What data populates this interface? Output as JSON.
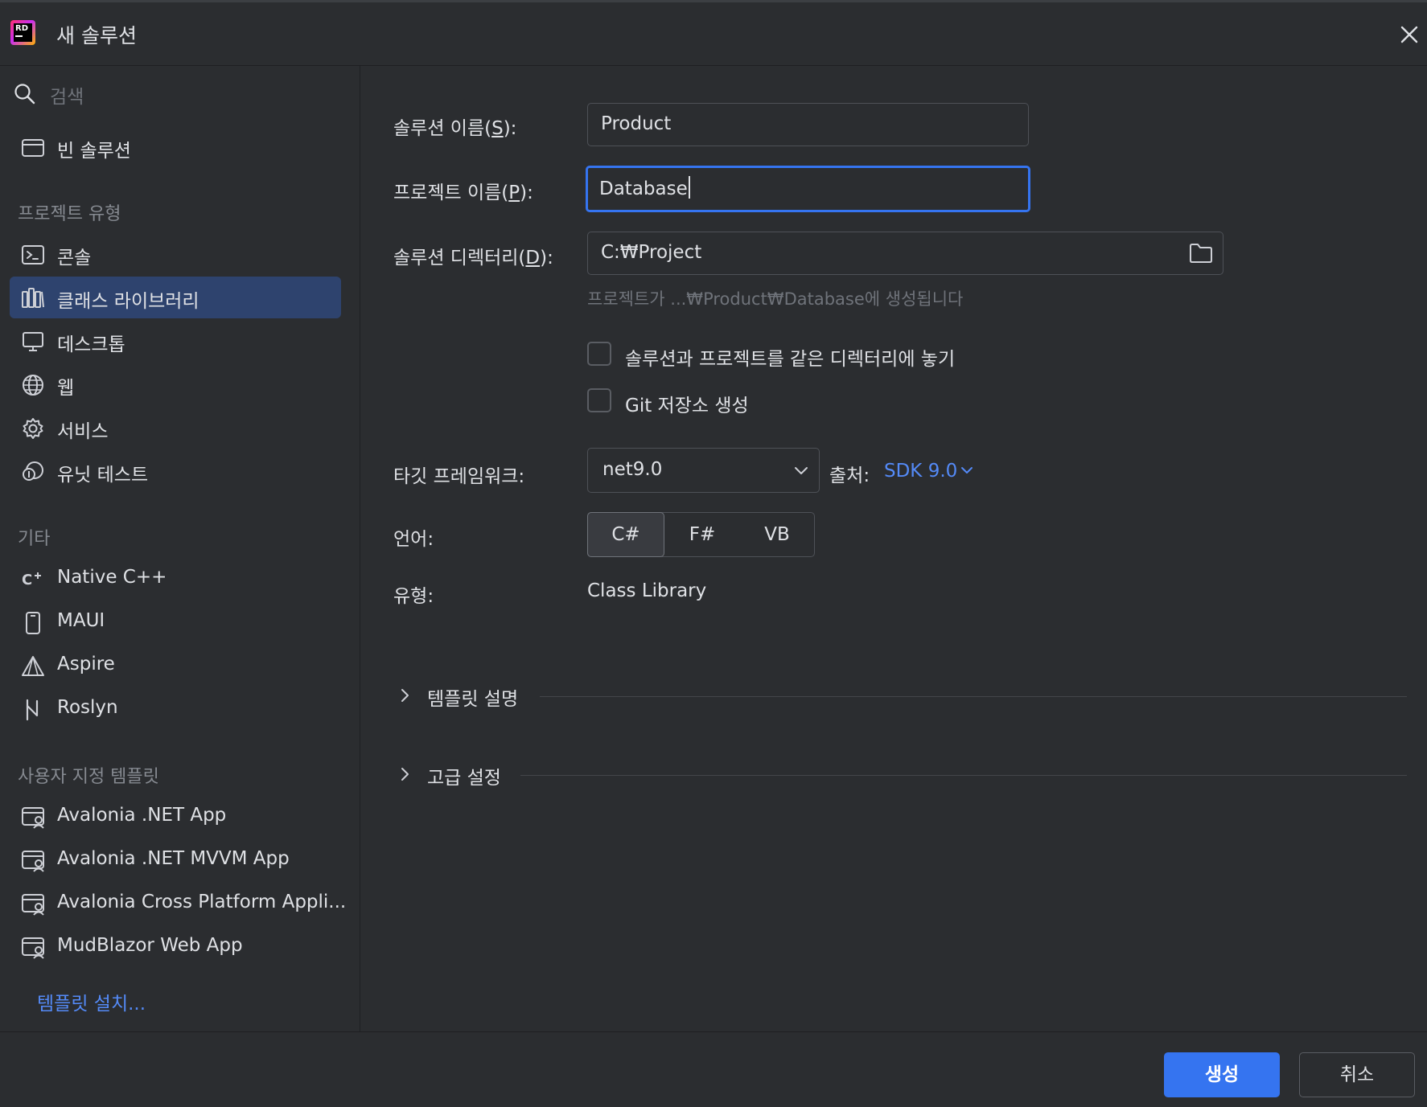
{
  "window": {
    "title": "새 솔루션",
    "logo_text": "RD"
  },
  "sidebar": {
    "search_placeholder": "검색",
    "top_items": [
      {
        "label": "빈 솔루션",
        "icon": "window-icon"
      }
    ],
    "project_types": {
      "header": "프로젝트 유형",
      "items": [
        {
          "label": "콘솔",
          "icon": "terminal-icon"
        },
        {
          "label": "클래스 라이브러리",
          "icon": "library-icon",
          "selected": true
        },
        {
          "label": "데스크톱",
          "icon": "monitor-icon"
        },
        {
          "label": "웹",
          "icon": "globe-icon"
        },
        {
          "label": "서비스",
          "icon": "gear-icon"
        },
        {
          "label": "유닛 테스트",
          "icon": "unit-test-icon"
        }
      ]
    },
    "other": {
      "header": "기타",
      "items": [
        {
          "label": "Native C++",
          "icon": "cpp-icon"
        },
        {
          "label": "MAUI",
          "icon": "phone-icon"
        },
        {
          "label": "Aspire",
          "icon": "aspire-icon"
        },
        {
          "label": "Roslyn",
          "icon": "roslyn-icon"
        }
      ]
    },
    "custom_templates": {
      "header": "사용자 지정 템플릿",
      "items": [
        {
          "label": "Avalonia .NET App",
          "icon": "template-icon"
        },
        {
          "label": "Avalonia .NET MVVM App",
          "icon": "template-icon"
        },
        {
          "label": "Avalonia Cross Platform Appli...",
          "icon": "template-icon"
        },
        {
          "label": "MudBlazor Web App",
          "icon": "template-icon"
        }
      ]
    },
    "install_templates": "템플릿 설치..."
  },
  "form": {
    "solution_name": {
      "label_pre": "솔루션 이름(",
      "mnemonic": "S",
      "label_post": "):",
      "value": "Product"
    },
    "project_name": {
      "label_pre": "프로젝트 이름(",
      "mnemonic": "P",
      "label_post": "):",
      "value": "Database"
    },
    "solution_dir": {
      "label_pre": "솔루션 디렉터리(",
      "mnemonic": "D",
      "label_post": "):",
      "value": "C:₩Project"
    },
    "location_hint": "프로젝트가 ...₩Product₩Database에 생성됩니다",
    "same_dir_checkbox": {
      "label": "솔루션과 프로젝트를 같은 디렉터리에 놓기",
      "checked": false
    },
    "git_checkbox": {
      "label": "Git 저장소 생성",
      "checked": false
    },
    "target_framework": {
      "label": "타깃 프레임워크:",
      "value": "net9.0"
    },
    "source": {
      "label": "출처:",
      "value": "SDK 9.0"
    },
    "language": {
      "label": "언어:",
      "options": [
        "C#",
        "F#",
        "VB"
      ],
      "selected": "C#"
    },
    "type": {
      "label": "유형:",
      "value": "Class Library"
    },
    "sections": [
      {
        "title": "템플릿 설명",
        "expanded": false
      },
      {
        "title": "고급 설정",
        "expanded": false
      }
    ]
  },
  "footer": {
    "create_label": "생성",
    "cancel_label": "취소"
  },
  "colors": {
    "background": "#2b2d30",
    "selected_item": "#2e436e",
    "accent": "#3574f0",
    "link": "#548af7",
    "text": "#dfe1e5",
    "muted_text": "#6f737a"
  }
}
